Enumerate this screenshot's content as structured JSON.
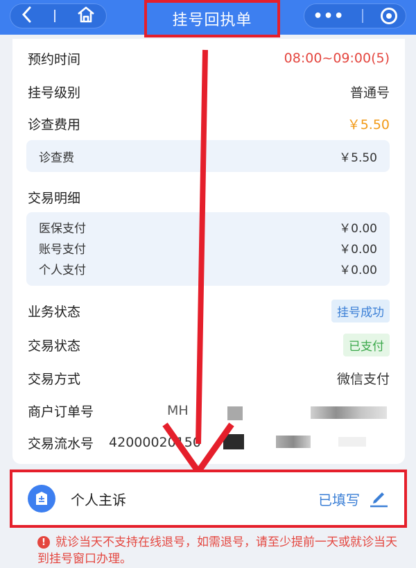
{
  "header": {
    "title": "挂号回执单",
    "back_icon": "back-arrow-icon",
    "home_icon": "home-icon",
    "more_icon": "more-dots-icon",
    "close_icon": "target-circle-icon"
  },
  "details": {
    "appointment_time": {
      "label": "预约时间",
      "value": "08:00~09:00(5)"
    },
    "registration_level": {
      "label": "挂号级别",
      "value": "普通号"
    },
    "consultation_fee": {
      "label": "诊查费用",
      "value": "￥5.50"
    },
    "fee_breakdown": [
      {
        "label": "诊查费",
        "value": "￥5.50"
      }
    ],
    "transaction_detail_label": "交易明细",
    "transaction_breakdown": [
      {
        "label": "医保支付",
        "value": "￥0.00"
      },
      {
        "label": "账号支付",
        "value": "￥0.00"
      },
      {
        "label": "个人支付",
        "value": "￥0.00"
      }
    ],
    "business_status": {
      "label": "业务状态",
      "value": "挂号成功"
    },
    "transaction_status": {
      "label": "交易状态",
      "value": "已支付"
    },
    "payment_method": {
      "label": "交易方式",
      "value": "微信支付"
    },
    "merchant_order": {
      "label": "商户订单号",
      "value": "MH"
    },
    "transaction_serial": {
      "label": "交易流水号",
      "value": "42000020150"
    }
  },
  "complaint": {
    "title": "个人主诉",
    "status": "已填写",
    "icon": "clipboard-icon",
    "edit_icon": "pencil-icon"
  },
  "notice": {
    "text": "就诊当天不支持在线退号，如需退号，请至少提前一天或就诊当天到挂号窗口办理。"
  },
  "colors": {
    "primary": "#3d7ff0",
    "highlight_border": "#e51f2b",
    "time_red": "#e4463f",
    "fee_orange": "#f29a17",
    "success_green": "#3aa84a"
  }
}
